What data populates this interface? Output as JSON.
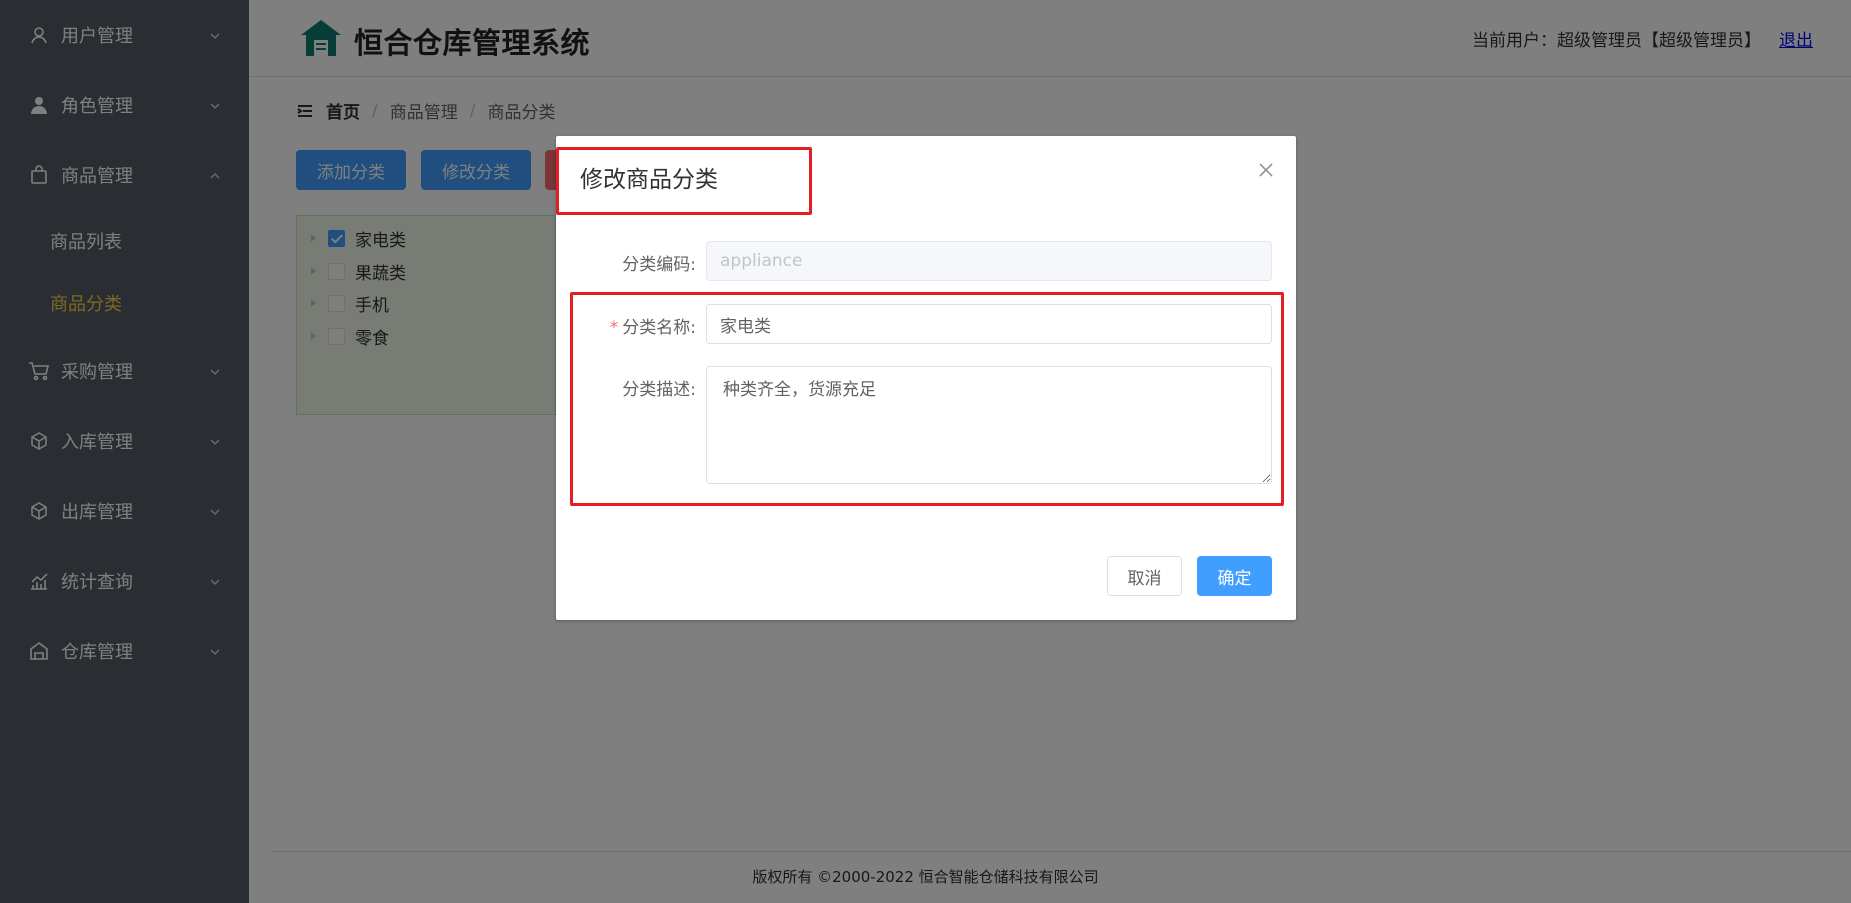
{
  "sidebar": {
    "items": [
      {
        "label": "用户管理",
        "icon": "user-icon",
        "expanded": false
      },
      {
        "label": "角色管理",
        "icon": "role-icon",
        "expanded": false
      },
      {
        "label": "商品管理",
        "icon": "bag-icon",
        "expanded": true,
        "children": [
          {
            "label": "商品列表",
            "active": false
          },
          {
            "label": "商品分类",
            "active": true
          }
        ]
      },
      {
        "label": "采购管理",
        "icon": "cart-icon",
        "expanded": false
      },
      {
        "label": "入库管理",
        "icon": "inbound-icon",
        "expanded": false
      },
      {
        "label": "出库管理",
        "icon": "outbound-icon",
        "expanded": false
      },
      {
        "label": "统计查询",
        "icon": "chart-icon",
        "expanded": false
      },
      {
        "label": "仓库管理",
        "icon": "warehouse-icon",
        "expanded": false
      }
    ]
  },
  "header": {
    "title": "恒合仓库管理系统",
    "current_user_label": "当前用户：超级管理员【超级管理员】",
    "logout": "退出"
  },
  "breadcrumb": [
    "首页",
    "商品管理",
    "商品分类"
  ],
  "toolbar": {
    "add": "添加分类",
    "edit": "修改分类"
  },
  "tree": [
    {
      "label": "家电类",
      "checked": true
    },
    {
      "label": "果蔬类",
      "checked": false
    },
    {
      "label": "手机",
      "checked": false
    },
    {
      "label": "零食",
      "checked": false
    }
  ],
  "footer": "版权所有 ©2000-2022  恒合智能仓储科技有限公司",
  "dialog": {
    "title": "修改商品分类",
    "code_label": "分类编码:",
    "code_value": "appliance",
    "name_required": "*",
    "name_label": "分类名称:",
    "name_value": "家电类",
    "desc_label": "分类描述:",
    "desc_value": "种类齐全，货源充足",
    "cancel": "取消",
    "confirm": "确定"
  },
  "colors": {
    "sidebar_bg": "#545c64",
    "active_menu": "#ffd04b",
    "primary": "#409eff",
    "highlight": "#e31e24"
  }
}
